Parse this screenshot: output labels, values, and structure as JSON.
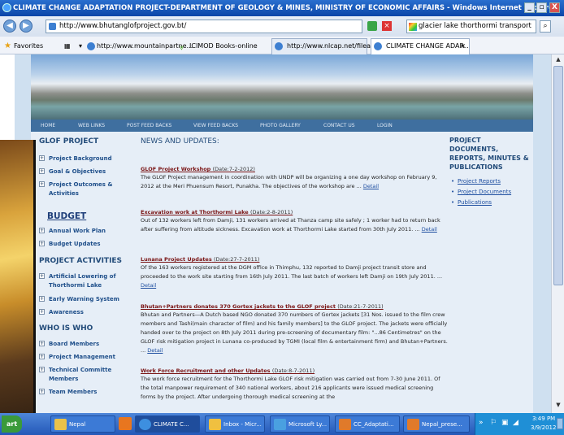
{
  "window": {
    "title": "CLIMATE CHANGE ADAPTATION PROJECT-DEPARTMENT OF GEOLOGY & MINES, MINISTRY OF ECONOMIC AFFAIRS - Windows Internet Explorer",
    "minimize": "_",
    "restore": " ",
    "close": "X"
  },
  "address": {
    "back": "◀",
    "forward": "▶",
    "url": "http://www.bhutanglofproject.gov.bt/",
    "search_text": "glacier lake thorthormi transport"
  },
  "favorites": {
    "label": "Favorites",
    "links": [
      "http://www.mountainpartne...",
      "ICIMOD Books-online"
    ],
    "tabs": [
      "http://www.nlcap.net/filead...",
      "CLIMATE CHANGE ADAP..."
    ]
  },
  "nav": [
    "HOME",
    "WEB LINKS",
    "POST FEED BACKS",
    "VIEW FEED BACKS",
    "PHOTO GALLERY",
    "CONTACT US",
    "LOGIN"
  ],
  "sidebar": {
    "glof_title": "GLOF PROJECT",
    "glof_items": [
      "Project Background",
      "Goal & Objectives",
      "Project Outcomes & Activities"
    ],
    "budget_title": "BUDGET",
    "budget_items": [
      "Annual Work Plan",
      "Budget Updates"
    ],
    "activities_title": "PROJECT ACTIVITIES",
    "activities_items": [
      "Artificial Lowering of Thorthormi Lake",
      "Early Warning System",
      "Awareness"
    ],
    "who_title": "WHO IS WHO",
    "who_items": [
      "Board Members",
      "Project Management",
      "Technical Committe Members",
      "Team Members"
    ]
  },
  "news": {
    "heading": "NEWS AND UPDATES:",
    "detail": "Detail",
    "items": [
      {
        "title": "GLOF Project Workshop",
        "date": "(Date:7-2-2012)",
        "body": "The GLOF Project management in coordination with UNDP will be organizing a one day workshop on February 9, 2012 at the Meri Phuensum Resort, Punakha. The objectives of the workshop are ..."
      },
      {
        "title": "Excavation work at Thorthormi Lake",
        "date": "(Date:2-8-2011)",
        "body": "Out of 132 workers left from Damji, 131 workers arrived at Thanza camp site safely ; 1 worker had to return back after suffering from altitude sickness. Excavation work at Thorthormi Lake started from 30th July 2011. ..."
      },
      {
        "title": "Lunana Project Updates",
        "date": "(Date:27-7-2011)",
        "body": "Of the 163 workers registered at the DGM office in Thimphu, 132 reported to Damji project transit store and proceeded to the work site starting from 16th July 2011. The last batch of workers left Damji on 19th July 2011. ..."
      },
      {
        "title": "Bhutan+Partners donates 370 Gortex jackets to the GLOF project",
        "date": "(Date:21-7-2011)",
        "body": "Bhutan and Partners—A Dutch based NGO donated 370 numbers of Gortex jackets [31 Nos. issued to the film crew members and Tashi(main character of film) and his family members] to the GLOF project. The jackets were officially handed over to the project on 8th July 2011 during pre-screening of documentary film: \"...86 Centimetres\" on the GLOF risk mitigation project in Lunana co-produced by TGMI (local film & entertainment firm) and Bhutan+Partners. ..."
      },
      {
        "title": "Work Force Recruitment and other Updates",
        "date": "(Date:8-7-2011)",
        "body": "The work force recruitment for the Thorthormi Lake GLOF risk mitigation was carried out from 7-30 June 2011. Of the total manpower requirement of 340 national workers, about 216 applicants were issued medical screening forms by the project. After undergoing thorough medical screening at the"
      }
    ]
  },
  "publications": {
    "title": "PROJECT DOCUMENTS, REPORTS, MINUTES & PUBLICATIONS",
    "links": [
      "Project Reports",
      "Project Documents",
      "Publications"
    ]
  },
  "taskbar": {
    "start": "art",
    "items": [
      "Nepal",
      "CLIMATE C...",
      "Inbox - Micr...",
      "Microsoft Ly...",
      "CC_Adaptati...",
      "Nepal_prese..."
    ],
    "time": "3:49 PM",
    "date": "3/9/2012"
  }
}
